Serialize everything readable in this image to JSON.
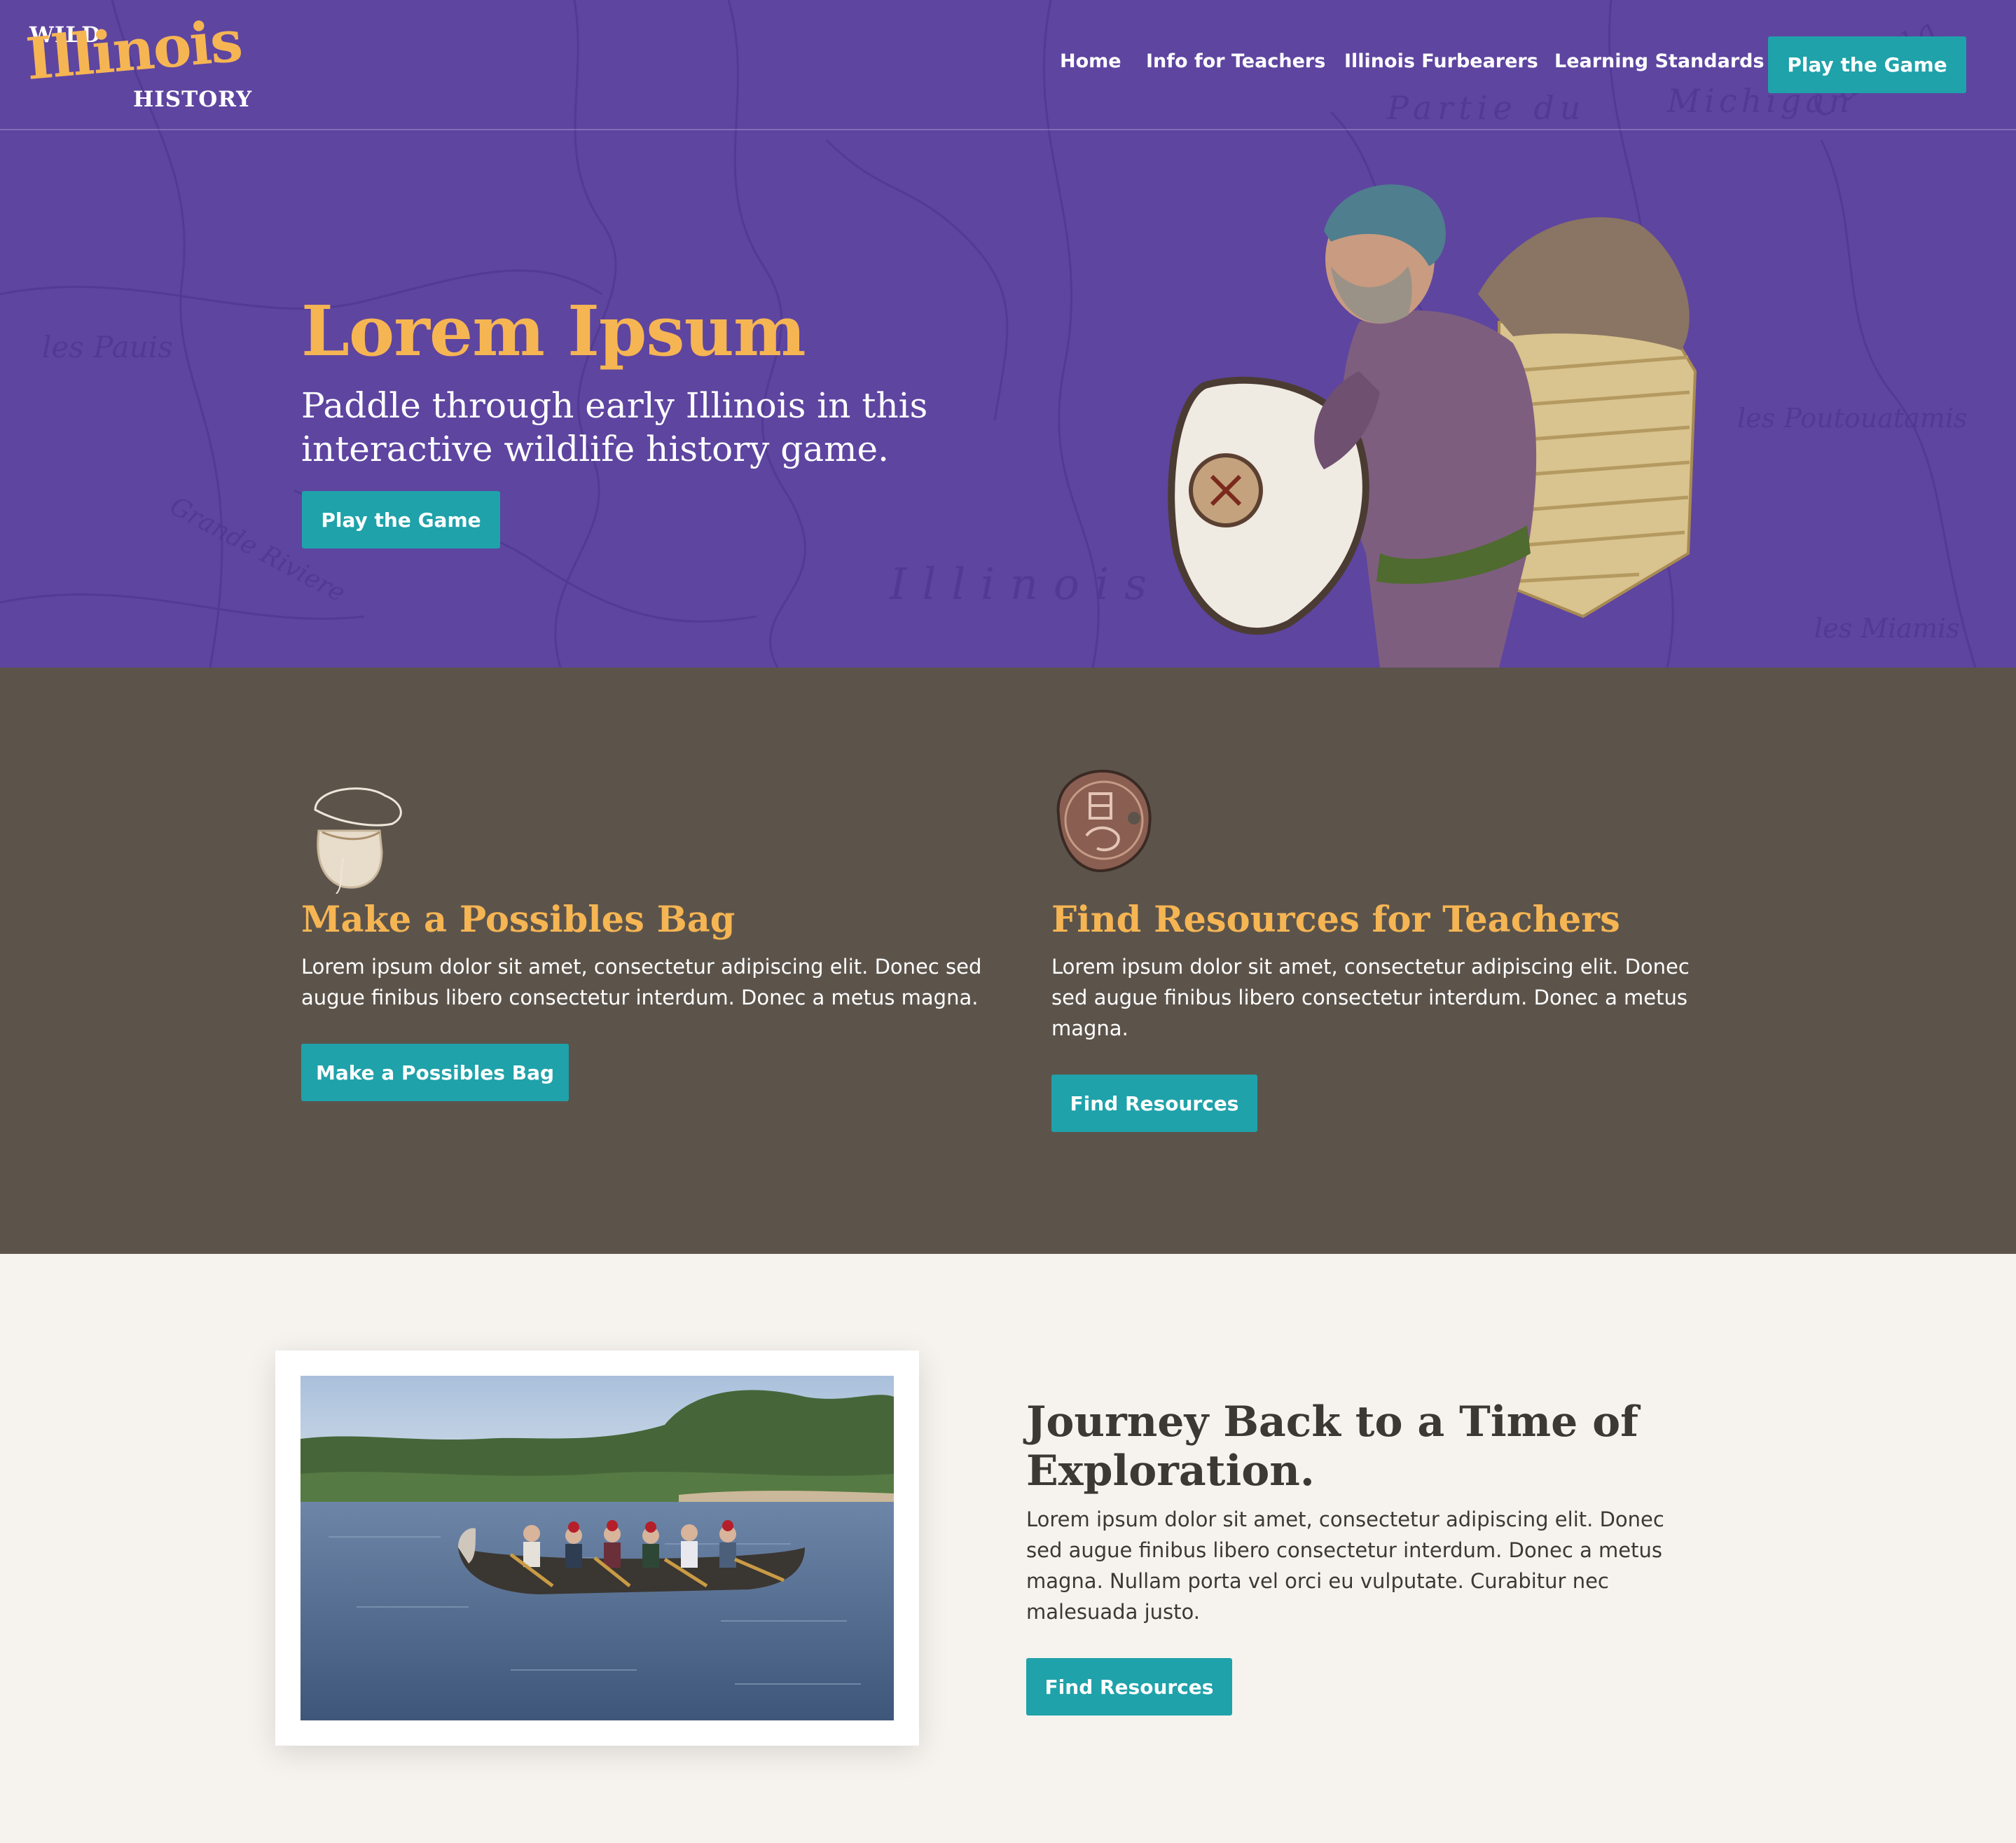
{
  "logo": {
    "line1": "WILD",
    "line2": "Illinois",
    "line3": "HISTORY"
  },
  "nav": {
    "items": [
      {
        "label": "Home"
      },
      {
        "label": "Info for Teachers"
      },
      {
        "label": "Illinois Furbearers"
      },
      {
        "label": "Learning Standards"
      }
    ],
    "cta": "Play the Game"
  },
  "hero": {
    "title": "Lorem Ipsum",
    "subtitle": "Paddle through early Illinois in this interactive wildlife history game.",
    "cta": "Play the Game",
    "map_labels": [
      "les Pauis",
      "Illinois",
      "les Miamis",
      "les Poutouatamis",
      "Grande Riviere",
      "Michigan",
      "Canada",
      "Partie du"
    ]
  },
  "features": [
    {
      "icon": "possibles-bag-icon",
      "title": "Make a Possibles Bag",
      "body": "Lorem ipsum dolor sit amet, consectetur adipiscing elit. Donec sed augue finibus libero consectetur interdum. Donec a metus magna.",
      "cta": "Make a Possibles Bag"
    },
    {
      "icon": "coin-icon",
      "title": "Find Resources for Teachers",
      "body": "Lorem ipsum dolor sit amet, consectetur adipiscing elit. Donec sed augue finibus libero consectetur interdum. Donec a metus magna.",
      "cta": "Find Resources"
    }
  ],
  "journey": {
    "title": "Journey Back to a Time of Exploration.",
    "body": "Lorem ipsum dolor sit amet, consectetur adipiscing elit. Donec sed augue finibus libero consectetur interdum. Donec a metus magna. Nullam porta vel orci eu vulputate. Curabitur nec malesuada justo.",
    "cta": "Find Resources"
  },
  "colors": {
    "hero_purple": "#5e45a0",
    "accent_gold": "#f6b553",
    "button_teal": "#1fa2aa",
    "section_brown": "#5c544b",
    "section_cream": "#f6f3ee"
  }
}
